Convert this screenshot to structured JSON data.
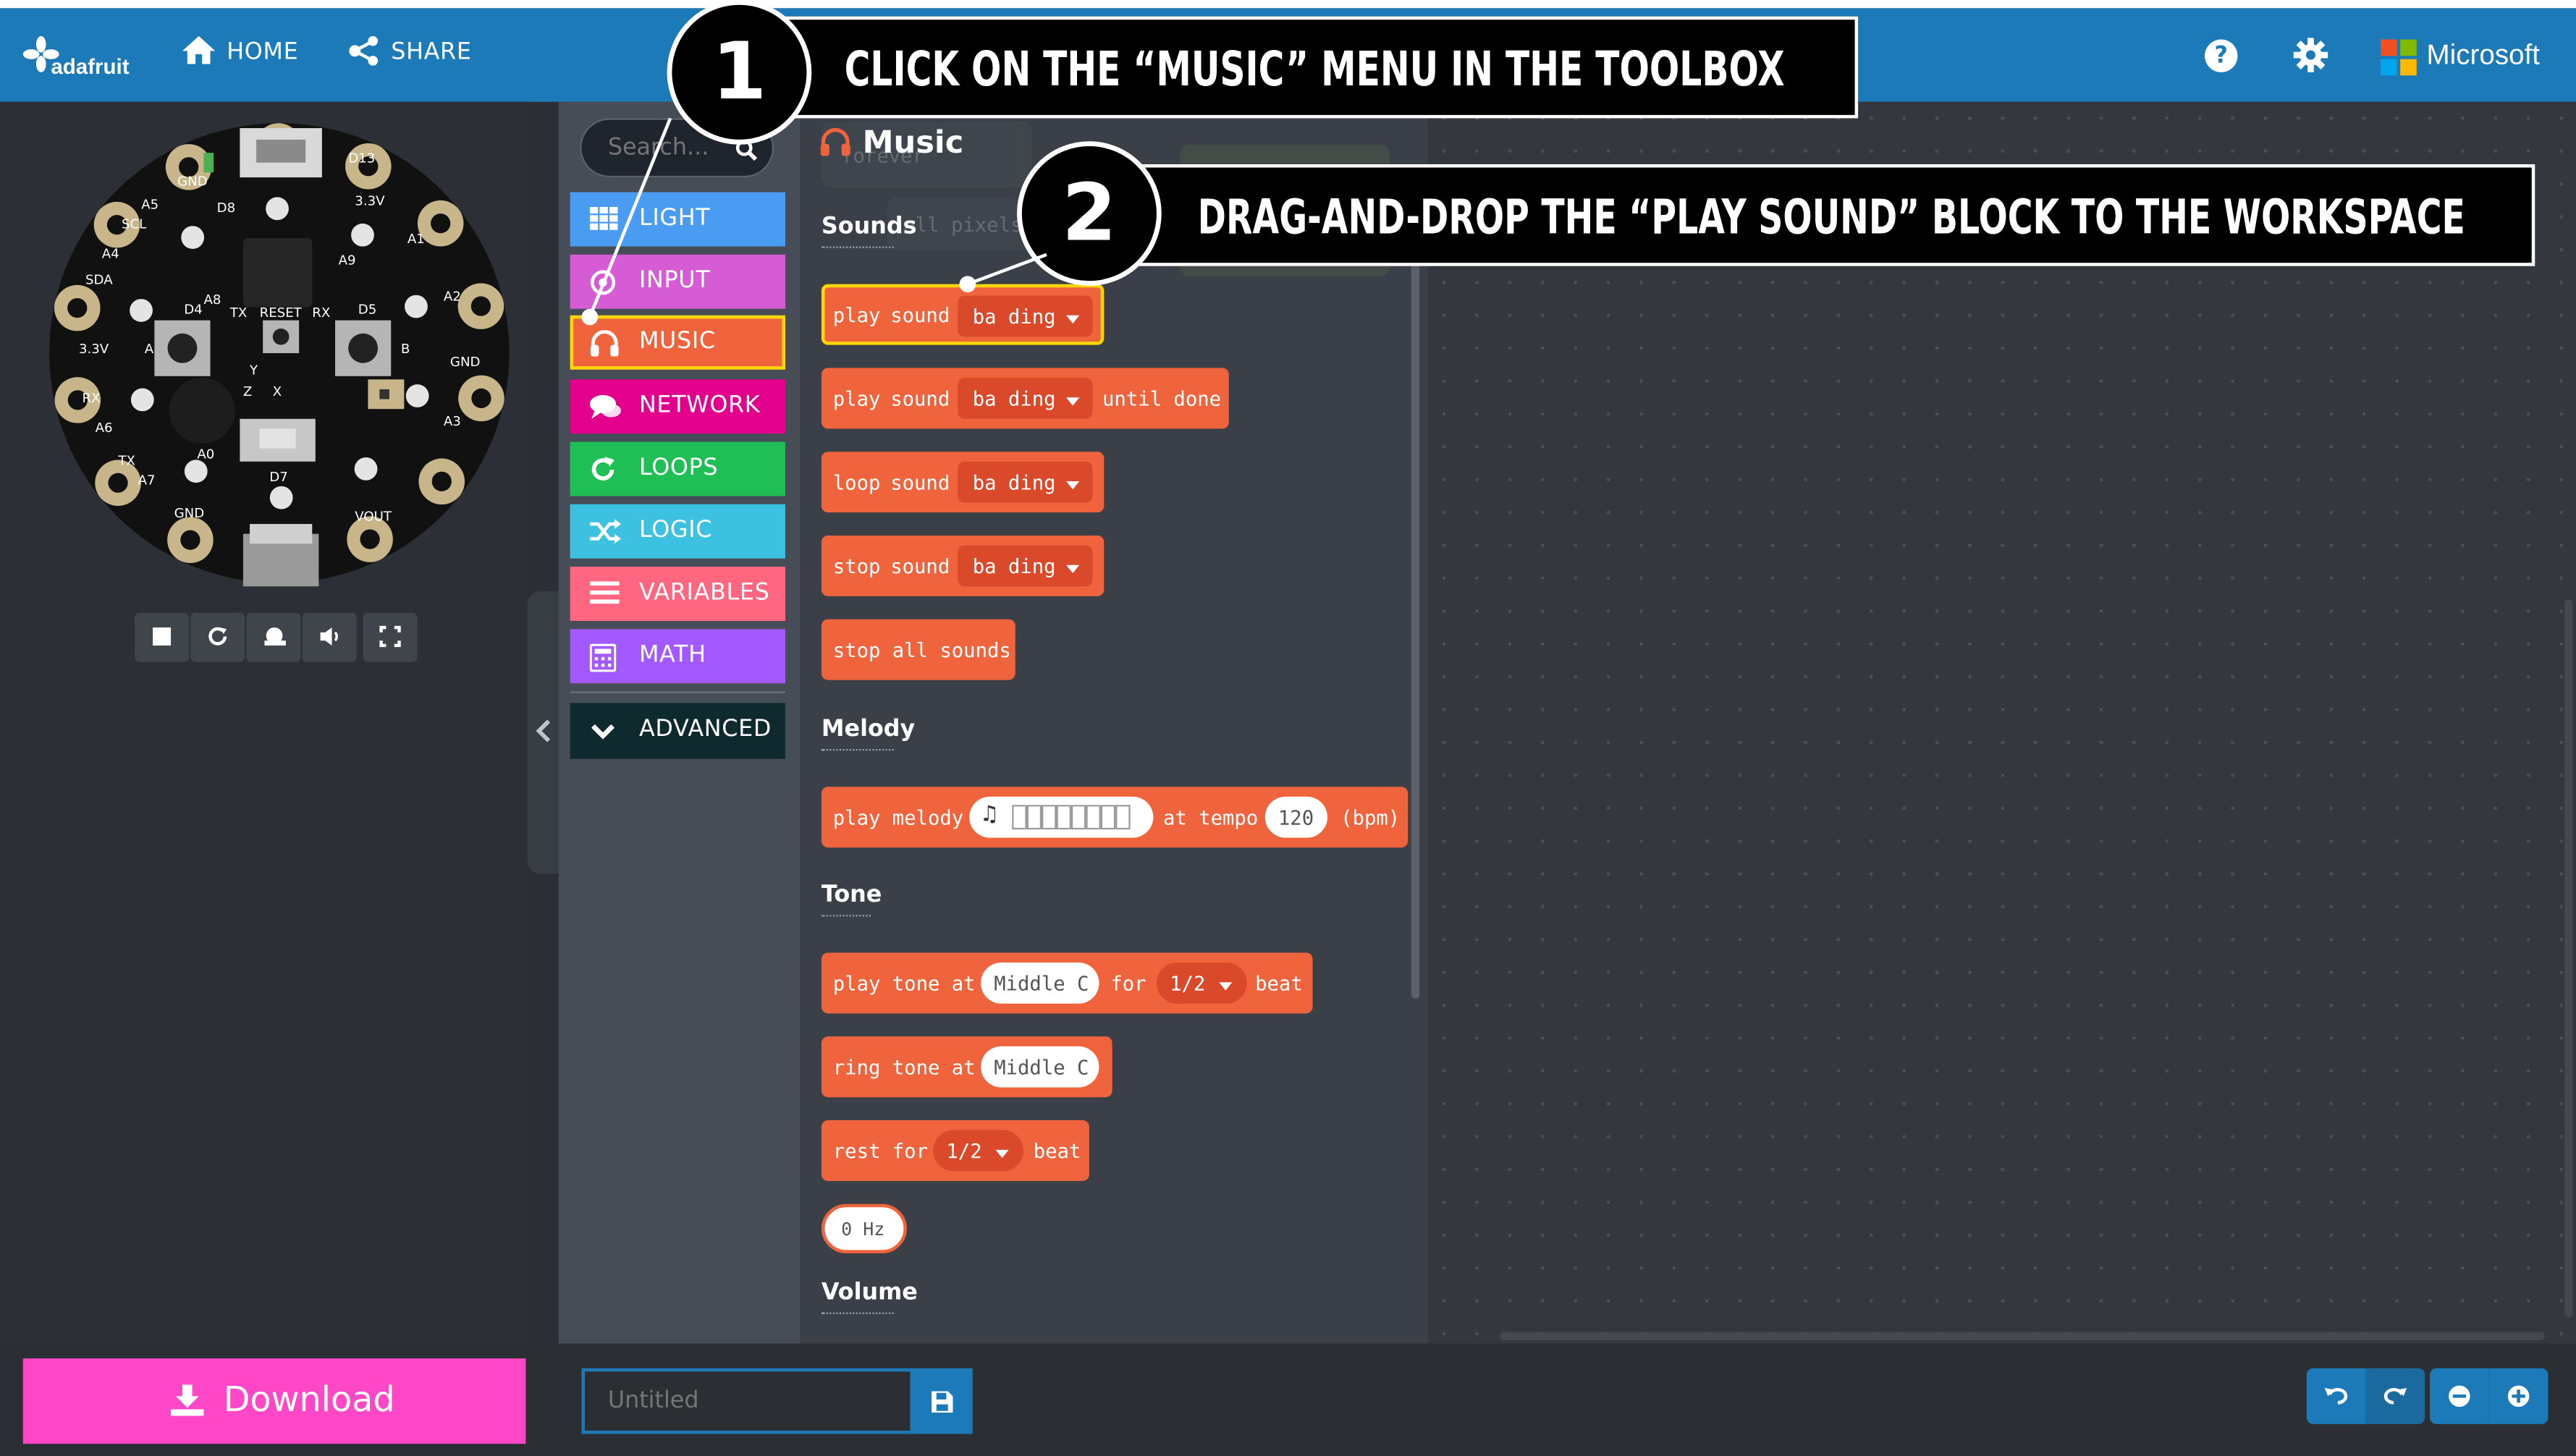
{
  "header": {
    "logo_text": "adafruit",
    "home_label": "HOME",
    "share_label": "SHARE",
    "brand_label": "Microsoft"
  },
  "board": {
    "pins": [
      "D13",
      "3.3V",
      "A1",
      "A2",
      "GND",
      "A3",
      "VOUT",
      "GND",
      "A7",
      "TX",
      "A6",
      "RX",
      "3.3V",
      "SDA",
      "A4",
      "SCL",
      "A5",
      "GND"
    ],
    "labels": [
      "D8",
      "A9",
      "A8",
      "D4",
      "TX",
      "RESET",
      "RX",
      "D5",
      "A0",
      "D7",
      "Y",
      "Z",
      "X",
      "A",
      "B"
    ]
  },
  "toolbox": {
    "search_placeholder": "Search...",
    "categories": [
      {
        "label": "LIGHT",
        "color": "#4a9cf2",
        "icon": "grid-icon"
      },
      {
        "label": "INPUT",
        "color": "#d65cd6",
        "icon": "target-icon"
      },
      {
        "label": "MUSIC",
        "color": "#f0643d",
        "icon": "headphones-icon"
      },
      {
        "label": "NETWORK",
        "color": "#e3008c",
        "icon": "chat-icon"
      },
      {
        "label": "LOOPS",
        "color": "#20bf55",
        "icon": "refresh-icon"
      },
      {
        "label": "LOGIC",
        "color": "#3cc1e1",
        "icon": "shuffle-icon"
      },
      {
        "label": "VARIABLES",
        "color": "#ff6680",
        "icon": "list-icon"
      },
      {
        "label": "MATH",
        "color": "#a259ff",
        "icon": "calculator-icon"
      },
      {
        "label": "ADVANCED",
        "color": "#0f2a2e",
        "icon": "chevron-down-icon"
      }
    ]
  },
  "flyout": {
    "title": "Music",
    "sections": {
      "sounds": "Sounds",
      "melody": "Melody",
      "tone": "Tone",
      "volume": "Volume"
    },
    "ghost": {
      "forever": "forever",
      "pixels": "all pixels"
    },
    "blocks": {
      "play_sound": {
        "w1": "play",
        "w2": "sound",
        "opt": "ba ding"
      },
      "play_sound_until": {
        "w1": "play",
        "w2": "sound",
        "opt": "ba ding",
        "tail": "until done"
      },
      "loop_sound": {
        "w1": "loop",
        "w2": "sound",
        "opt": "ba ding"
      },
      "stop_sound": {
        "w1": "stop",
        "w2": "sound",
        "opt": "ba ding"
      },
      "stop_all": "stop all sounds",
      "melody": {
        "w1": "play melody",
        "mid": "at tempo",
        "tempo": "120",
        "unit": "(bpm)"
      },
      "play_tone": {
        "w1": "play tone at",
        "note": "Middle C",
        "w2": "for",
        "beat": "1/2",
        "w3": "beat"
      },
      "ring_tone": {
        "w1": "ring tone at",
        "note": "Middle C"
      },
      "rest": {
        "w1": "rest for",
        "beat": "1/2",
        "w3": "beat"
      },
      "hz": "0 Hz"
    }
  },
  "footer": {
    "download_label": "Download",
    "project_name_placeholder": "Untitled"
  },
  "callouts": [
    {
      "number": "1",
      "text": "Click on the “Music” menu in the Toolbox"
    },
    {
      "number": "2",
      "text": "Drag-and-drop the “Play Sound” block to the Workspace"
    }
  ],
  "colors": {
    "header": "#1b7ab7",
    "music": "#f0643d",
    "download": "#ff47c7",
    "highlight": "#ffd600"
  }
}
